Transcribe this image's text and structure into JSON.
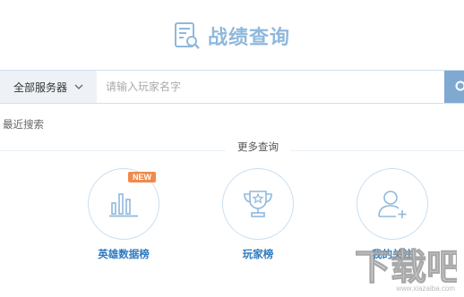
{
  "header": {
    "title": "战绩查询",
    "icon": "report-search-icon",
    "accent": "#8fb8dc"
  },
  "search": {
    "server_label": "全部服务器",
    "placeholder": "请输入玩家名字",
    "button_icon": "search-icon",
    "button_color": "#7fa9d1"
  },
  "recent": {
    "label": "最近搜索"
  },
  "more": {
    "label": "更多查询"
  },
  "features": [
    {
      "label": "英雄数据榜",
      "icon": "bar-chart-icon",
      "badge": "NEW"
    },
    {
      "label": "玩家榜",
      "icon": "trophy-icon"
    },
    {
      "label": "我的关注",
      "icon": "user-add-icon"
    }
  ],
  "watermark": {
    "text": "下载吧",
    "url": "www.xiazaiba.com"
  }
}
